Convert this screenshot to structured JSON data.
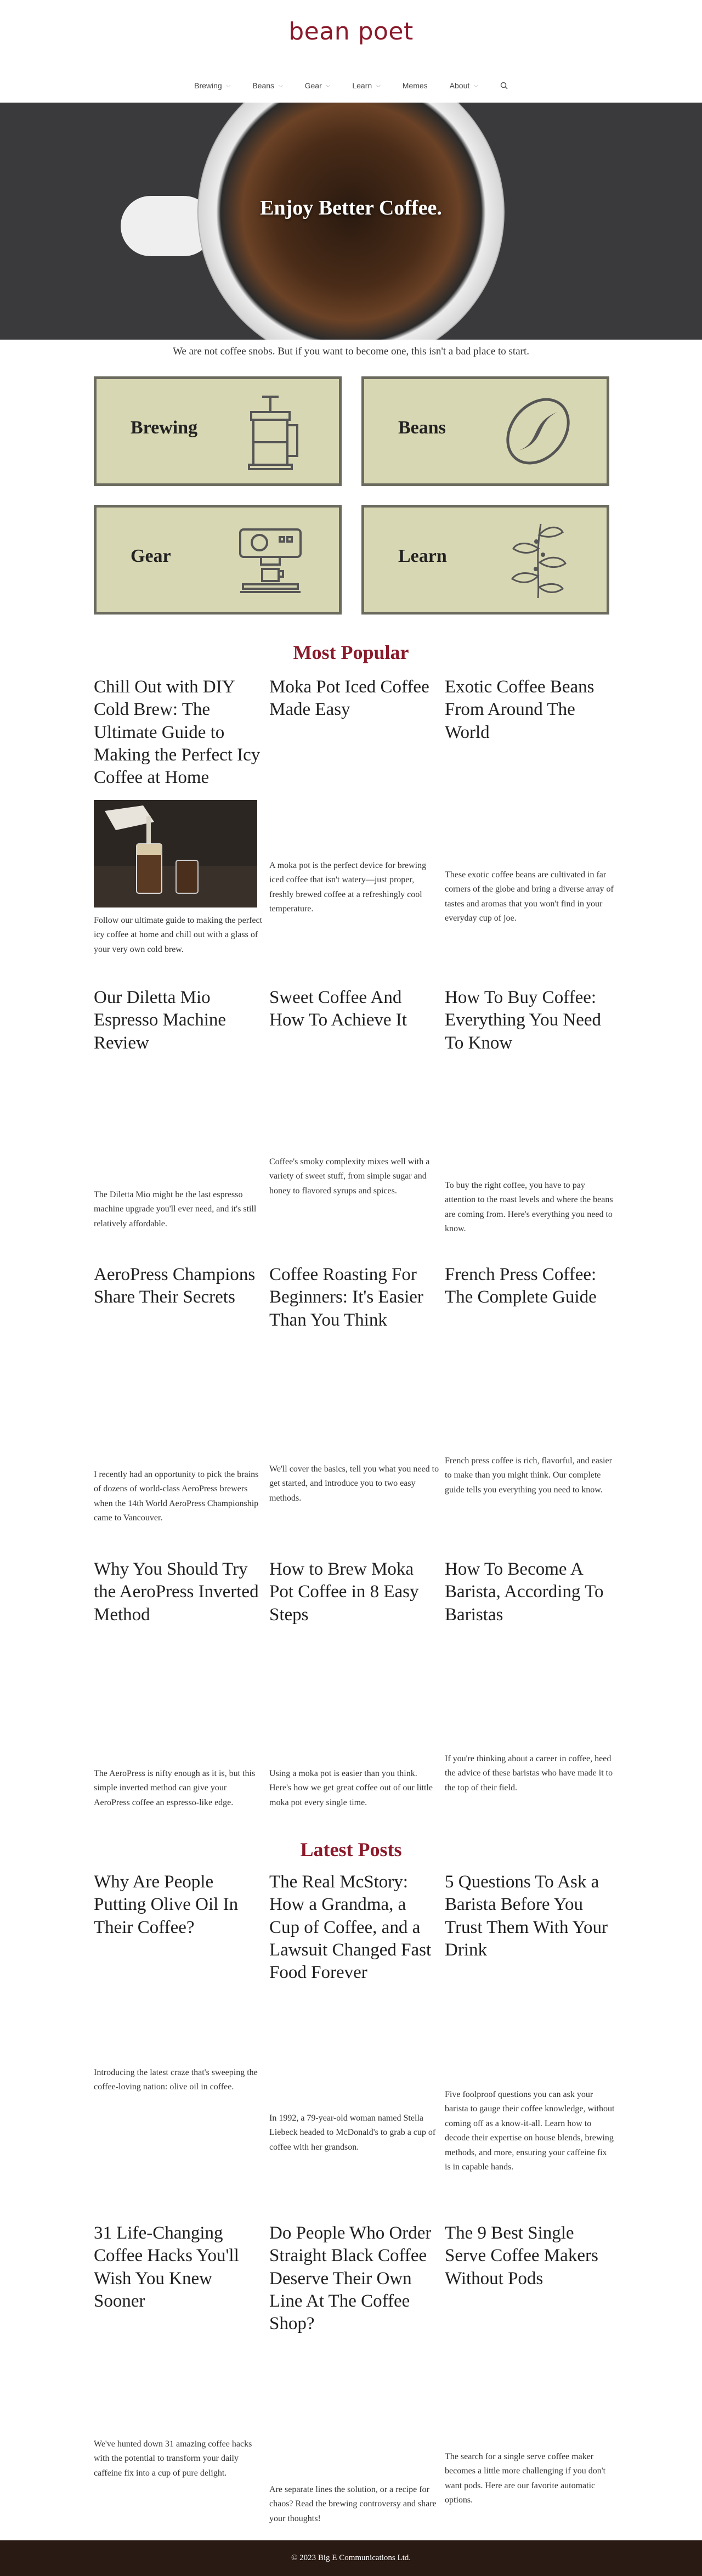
{
  "brand": {
    "name": "bean poet",
    "color": "#8b1a2b"
  },
  "nav": {
    "items": [
      {
        "label": "Brewing",
        "has_dropdown": true
      },
      {
        "label": "Beans",
        "has_dropdown": true
      },
      {
        "label": "Gear",
        "has_dropdown": true
      },
      {
        "label": "Learn",
        "has_dropdown": true
      },
      {
        "label": "Memes",
        "has_dropdown": false
      },
      {
        "label": "About",
        "has_dropdown": true
      }
    ],
    "search_icon": "search-icon"
  },
  "hero": {
    "title": "Enjoy Better Coffee."
  },
  "tagline": "We are not coffee snobs. But if you want to become one, this isn't a bad place to start.",
  "categories": [
    {
      "label": "Brewing",
      "icon": "french-press-icon"
    },
    {
      "label": "Beans",
      "icon": "coffee-bean-icon"
    },
    {
      "label": "Gear",
      "icon": "espresso-machine-icon"
    },
    {
      "label": "Learn",
      "icon": "coffee-plant-icon"
    }
  ],
  "most_popular": {
    "title": "Most Popular",
    "posts": [
      {
        "title": "Chill Out with DIY Cold Brew: The Ultimate Guide to Making the Perfect Icy Coffee at Home",
        "excerpt": "Follow our ultimate guide to making the perfect icy coffee at home and chill out with a glass of your very own cold brew."
      },
      {
        "title": "Moka Pot Iced Coffee Made Easy",
        "excerpt": "A moka pot is the perfect device for brewing iced coffee that isn't watery—just proper, freshly brewed coffee at a refreshingly cool temperature."
      },
      {
        "title": "Exotic Coffee Beans From Around The World",
        "excerpt": "These exotic coffee beans are cultivated in far corners of the globe and bring a diverse array of tastes and aromas that you won't find in your everyday cup of joe."
      },
      {
        "title": "Our Diletta Mio Espresso Machine Review",
        "excerpt": "The Diletta Mio might be the last espresso machine upgrade you'll ever need, and it's still relatively affordable."
      },
      {
        "title": "Sweet Coffee And How To Achieve It",
        "excerpt": "Coffee's smoky complexity mixes well with a variety of sweet stuff, from simple sugar and honey to flavored syrups and spices."
      },
      {
        "title": "How To Buy Coffee: Everything You Need To Know",
        "excerpt": "To buy the right coffee, you have to pay attention to the roast levels and where the beans are coming from. Here's everything you need to know."
      },
      {
        "title": "AeroPress Champions Share Their Secrets",
        "excerpt": "I recently had an opportunity to pick the brains of dozens of world-class AeroPress brewers when the 14th World AeroPress Championship came to Vancouver."
      },
      {
        "title": "Coffee Roasting For Beginners: It's Easier Than You Think",
        "excerpt": "We'll cover the basics, tell you what you need to get started, and introduce you to two easy methods."
      },
      {
        "title": "French Press Coffee: The Complete Guide",
        "excerpt": "French press coffee is rich, flavorful, and easier to make than you might think. Our complete guide tells you everything you need to know."
      },
      {
        "title": "Why You Should Try the AeroPress Inverted Method",
        "excerpt": "The AeroPress is nifty enough as it is, but this simple inverted method can give your AeroPress coffee an espresso-like edge."
      },
      {
        "title": "How to Brew Moka Pot Coffee in 8 Easy Steps",
        "excerpt": "Using a moka pot is easier than you think. Here's how we get great coffee out of our little moka pot every single time."
      },
      {
        "title": "How To Become A Barista, According To Baristas",
        "excerpt": "If you're thinking about a career in coffee, heed the advice of these baristas who have made it to the top of their field."
      }
    ]
  },
  "latest_posts": {
    "title": "Latest Posts",
    "posts": [
      {
        "title": "Why Are People Putting Olive Oil In Their Coffee?",
        "excerpt": "Introducing the latest craze that's sweeping the coffee-loving nation: olive oil in coffee."
      },
      {
        "title": "The Real McStory: How a Grandma, a Cup of Coffee, and a Lawsuit Changed Fast Food Forever",
        "excerpt": "In 1992, a 79-year-old woman named Stella Liebeck headed to McDonald's to grab a cup of coffee with her grandson."
      },
      {
        "title": "5 Questions To Ask a Barista Before You Trust Them With Your Drink",
        "excerpt": "Five foolproof questions you can ask your barista to gauge their coffee knowledge, without coming off as a know-it-all. Learn how to decode their expertise on house blends, brewing methods, and more, ensuring your caffeine fix is in capable hands."
      },
      {
        "title": "31 Life-Changing Coffee Hacks You'll Wish You Knew Sooner",
        "excerpt": "We've hunted down 31 amazing coffee hacks with the potential to transform your daily caffeine fix into a cup of pure delight."
      },
      {
        "title": "Do People Who Order Straight Black Coffee Deserve Their Own Line At The Coffee Shop?",
        "excerpt": "Are separate lines the solution, or a recipe for chaos? Read the brewing controversy and share your thoughts!"
      },
      {
        "title": "The 9 Best Single Serve Coffee Makers Without Pods",
        "excerpt": "The search for a single serve coffee maker becomes a little more challenging if you don't want pods. Here are our favorite automatic options."
      }
    ]
  },
  "footer": {
    "text": "© 2023 Big E Communications Ltd."
  }
}
